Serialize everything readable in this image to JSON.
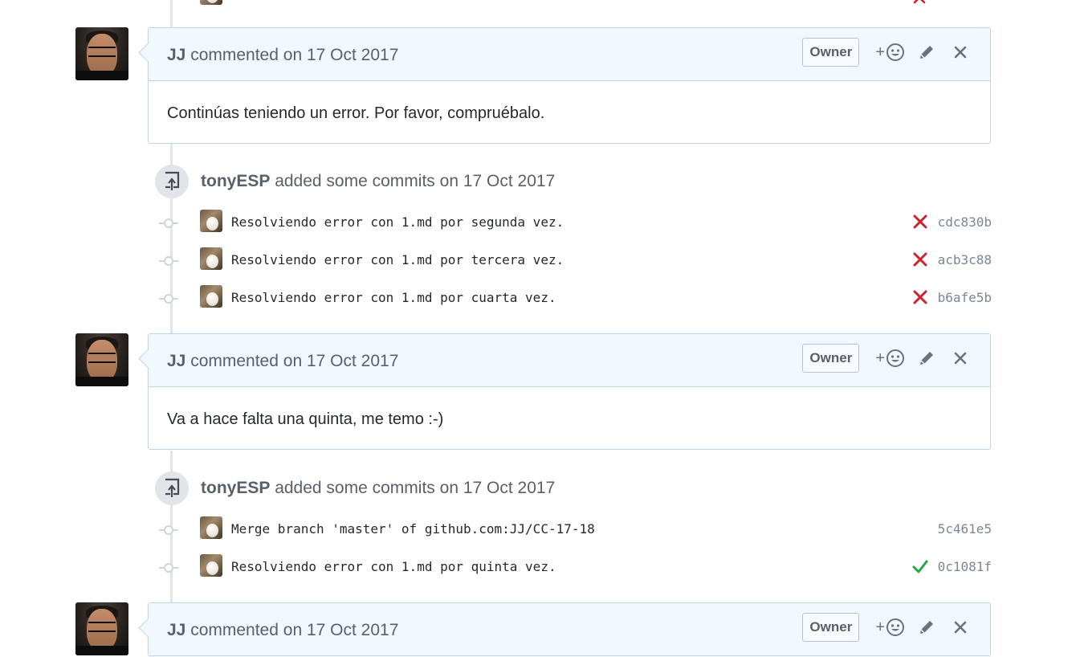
{
  "colors": {
    "fail": "#cb2431",
    "success": "#28a745",
    "header_bg": "#f1f8ff",
    "border": "#c0d3eb"
  },
  "comments": [
    {
      "author": "JJ",
      "action": "commented",
      "date": "on 17 Oct 2017",
      "badge": "Owner",
      "body": "Continúas teniendo un error. Por favor, compruébalo."
    },
    {
      "author": "JJ",
      "action": "commented",
      "date": "on 17 Oct 2017",
      "badge": "Owner",
      "body": "Va a hace falta una quinta, me temo :-)"
    },
    {
      "author": "JJ",
      "action": "commented",
      "date": "on 17 Oct 2017",
      "badge": "Owner",
      "body": ""
    }
  ],
  "pushes": [
    {
      "author": "tonyESP",
      "action": "added some commits",
      "date": "on 17 Oct 2017",
      "commits": [
        {
          "message": "Resolviendo error con 1.md por segunda vez.",
          "status": "x-icon",
          "sha": "cdc830b"
        },
        {
          "message": "Resolviendo error con 1.md por tercera vez.",
          "status": "x-icon",
          "sha": "acb3c88"
        },
        {
          "message": "Resolviendo error con 1.md por cuarta vez.",
          "status": "x-icon",
          "sha": "b6afe5b"
        }
      ]
    },
    {
      "author": "tonyESP",
      "action": "added some commits",
      "date": "on 17 Oct 2017",
      "commits": [
        {
          "message": "Merge branch 'master' of github.com:JJ/CC-17-18",
          "status": "",
          "sha": "5c461e5"
        },
        {
          "message": "Resolviendo error con 1.md por quinta vez.",
          "status": "check-icon",
          "sha": "0c1081f"
        }
      ]
    }
  ]
}
